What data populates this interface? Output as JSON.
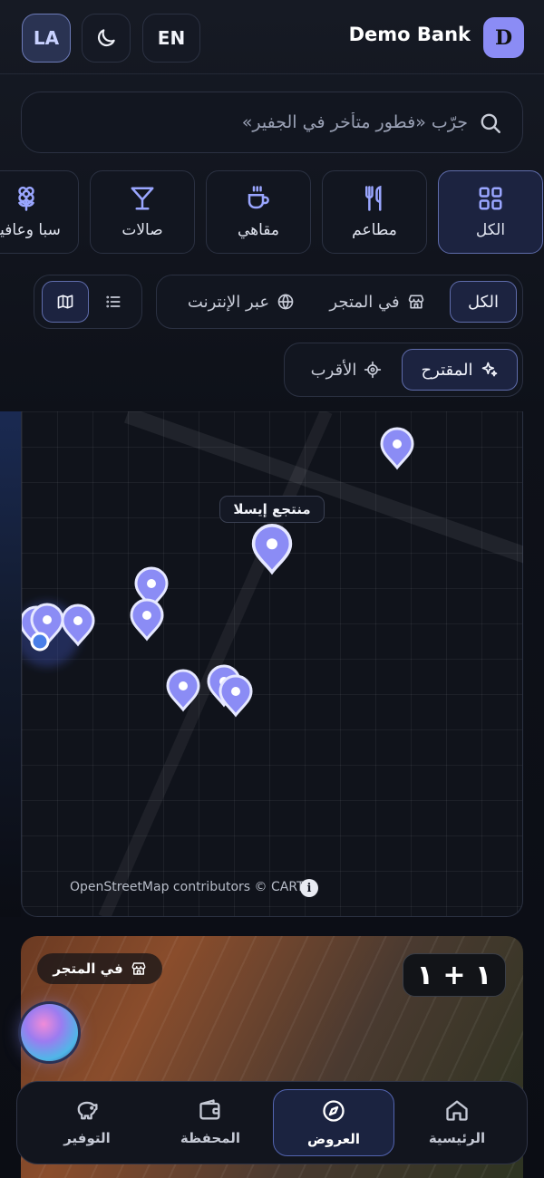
{
  "header": {
    "lang_short": "LA",
    "lang_toggle": "EN",
    "brand": "Demo Bank",
    "avatar_initial": "D",
    "theme_icon": "moon-icon"
  },
  "search": {
    "placeholder": "جرّب «فطور متأخر في الجفير»",
    "icon": "search-icon"
  },
  "categories": [
    {
      "label": "الكل",
      "icon": "grid-icon",
      "active": true
    },
    {
      "label": "مطاعم",
      "icon": "utensils-icon",
      "active": false
    },
    {
      "label": "مقاهي",
      "icon": "coffee-icon",
      "active": false
    },
    {
      "label": "صالات",
      "icon": "cocktail-icon",
      "active": false
    },
    {
      "label": "سبا وعافية",
      "icon": "flower-icon",
      "active": false
    }
  ],
  "channel_filter": {
    "options": [
      {
        "label": "الكل",
        "icon": "",
        "active": true
      },
      {
        "label": "في المتجر",
        "icon": "store-icon",
        "active": false
      },
      {
        "label": "عبر الإنترنت",
        "icon": "globe-icon",
        "active": false
      }
    ]
  },
  "view_toggle": {
    "map_icon": "map-icon",
    "list_icon": "list-icon",
    "active": "map"
  },
  "sort_filter": {
    "options": [
      {
        "label": "المقترح",
        "icon": "sparkles-icon",
        "active": true
      },
      {
        "label": "الأقرب",
        "icon": "crosshair-icon",
        "active": false
      }
    ]
  },
  "map": {
    "highlight_label": "منتجع إيسلا",
    "attribution": "OpenStreetMap contributors © CARTO",
    "info_label": "i",
    "pin_color": "#8b8cf5"
  },
  "offer": {
    "badge": "في المتجر",
    "badge_icon": "store-icon",
    "deal": "١ + ١"
  },
  "bottom_nav": [
    {
      "label": "الرئيسية",
      "icon": "home-icon",
      "active": false
    },
    {
      "label": "العروض",
      "icon": "compass-icon",
      "active": true
    },
    {
      "label": "المحفظة",
      "icon": "wallet-icon",
      "active": false
    },
    {
      "label": "التوفير",
      "icon": "piggy-bank-icon",
      "active": false
    }
  ]
}
